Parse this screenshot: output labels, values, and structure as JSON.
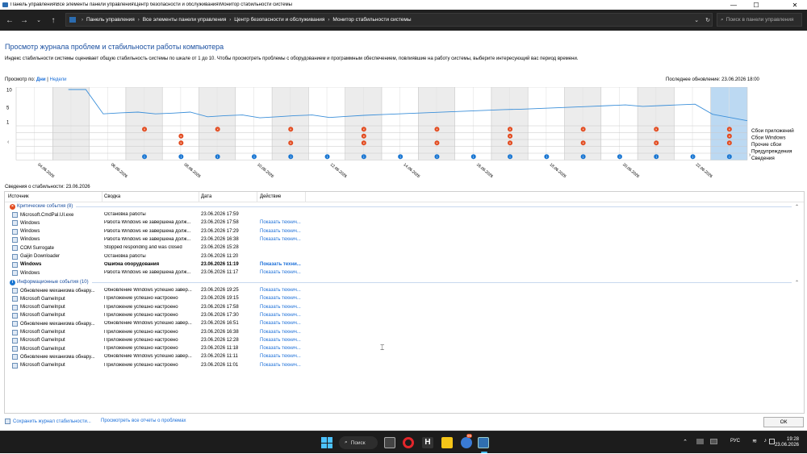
{
  "window": {
    "title": "Панель управления\\Все элементы панели управления\\Центр безопасности и обслуживания\\Монитор стабильности системы"
  },
  "nav": {
    "breadcrumbs": [
      "Панель управления",
      "Все элементы панели управления",
      "Центр безопасности и обслуживания",
      "Монитор стабильности системы"
    ],
    "search_placeholder": "Поиск в панели управления"
  },
  "heading": "Просмотр журнала проблем и стабильности работы компьютера",
  "description": "Индекс стабильности системы оценивает общую стабильность системы по шкале от 1 до 10. Чтобы просмотреть проблемы с оборудованием и программным обеспечением, повлиявшие на работу системы, выберите интересующий вас период времени.",
  "view_by": {
    "label": "Просмотр по:",
    "days": "Дни",
    "sep": "|",
    "weeks": "Недели"
  },
  "last_update": "Последнее обновление: 23.06.2026 18:00",
  "chart_data": {
    "type": "line",
    "yticks": [
      "10",
      "5",
      "1"
    ],
    "ylim": [
      1,
      10
    ],
    "dates": [
      "04.06.2026",
      "06.06.2026",
      "08.06.2026",
      "10.06.2026",
      "12.06.2026",
      "14.06.2026",
      "16.06.2026",
      "18.06.2026",
      "20.06.2026",
      "22.06.2026"
    ],
    "index_values": [
      null,
      null,
      null,
      10,
      10,
      3.2,
      3.5,
      3.7,
      3.2,
      3.4,
      3.7,
      2.4,
      2.7,
      2.9,
      2.1,
      2.4,
      2.7,
      2.9,
      2.2,
      2.5,
      2.8,
      3.0,
      3.2,
      3.4,
      3.6,
      3.8,
      4.0,
      4.2,
      4.4,
      4.5,
      4.7,
      4.9,
      5.1,
      5.3,
      5.5,
      5.7,
      5.3,
      5.5,
      5.7,
      5.9,
      3.1,
      2.2,
      1.3
    ],
    "rows": [
      "Сбои приложений",
      "Сбои Windows",
      "Прочие сбои",
      "Предупреждения",
      "Сведения"
    ],
    "selected_day_index": 19,
    "markers": {
      "app_failures": [
        3,
        5,
        7,
        9,
        11,
        13,
        15,
        17,
        19
      ],
      "windows_failures": [
        4,
        9,
        13,
        19
      ],
      "other_failures": [
        4,
        7,
        9,
        11,
        13,
        15,
        17,
        19
      ],
      "information": [
        3,
        4,
        5,
        6,
        7,
        8,
        9,
        10,
        11,
        12,
        13,
        14,
        15,
        16,
        17,
        18,
        19
      ]
    }
  },
  "stability_info": "Сведения о стабильности: 23.06.2026",
  "table": {
    "headers": [
      "Источник",
      "Сводка",
      "Дата",
      "Действие"
    ],
    "critical": {
      "label": "Критические события (8)",
      "rows": [
        {
          "source": "Microsoft.CmdPal.UI.exe",
          "summary": "Остановка работы",
          "date": "23.06.2026 17:59",
          "action": ""
        },
        {
          "source": "Windows",
          "summary": "Работа Windows не завершена долж...",
          "date": "23.06.2026 17:58",
          "action": "Показать технич..."
        },
        {
          "source": "Windows",
          "summary": "Работа Windows не завершена долж...",
          "date": "23.06.2026 17:29",
          "action": "Показать технич..."
        },
        {
          "source": "Windows",
          "summary": "Работа Windows не завершена долж...",
          "date": "23.06.2026 16:38",
          "action": "Показать технич..."
        },
        {
          "source": "COM Surrogate",
          "summary": "Stopped responding and was closed",
          "date": "23.06.2026 15:28",
          "action": ""
        },
        {
          "source": "Gaijin Downloader",
          "summary": "Остановка работы",
          "date": "23.06.2026 11:20",
          "action": ""
        },
        {
          "source": "Windows",
          "summary": "Ошибка оборудования",
          "date": "23.06.2026 11:19",
          "action": "Показать техни..."
        },
        {
          "source": "Windows",
          "summary": "Работа Windows не завершена долж...",
          "date": "23.06.2026 11:17",
          "action": "Показать технич..."
        }
      ]
    },
    "info": {
      "label": "Информационные события (10)",
      "rows": [
        {
          "source": "Обновление механизма обнару...",
          "summary": "Обновление Windows успешно завер...",
          "date": "23.06.2026 19:25",
          "action": "Показать технич..."
        },
        {
          "source": "Microsoft GameInput",
          "summary": "Приложение успешно настроено",
          "date": "23.06.2026 19:15",
          "action": "Показать технич..."
        },
        {
          "source": "Microsoft GameInput",
          "summary": "Приложение успешно настроено",
          "date": "23.06.2026 17:58",
          "action": "Показать технич..."
        },
        {
          "source": "Microsoft GameInput",
          "summary": "Приложение успешно настроено",
          "date": "23.06.2026 17:30",
          "action": "Показать технич..."
        },
        {
          "source": "Обновление механизма обнару...",
          "summary": "Обновление Windows успешно завер...",
          "date": "23.06.2026 16:51",
          "action": "Показать технич..."
        },
        {
          "source": "Microsoft GameInput",
          "summary": "Приложение успешно настроено",
          "date": "23.06.2026 16:38",
          "action": "Показать технич..."
        },
        {
          "source": "Microsoft GameInput",
          "summary": "Приложение успешно настроено",
          "date": "23.06.2026 12:28",
          "action": "Показать технич..."
        },
        {
          "source": "Microsoft GameInput",
          "summary": "Приложение успешно настроено",
          "date": "23.06.2026 11:18",
          "action": "Показать технич..."
        },
        {
          "source": "Обновление механизма обнару...",
          "summary": "Обновление Windows успешно завер...",
          "date": "23.06.2026 11:11",
          "action": "Показать технич..."
        },
        {
          "source": "Microsoft GameInput",
          "summary": "Приложение успешно настроено",
          "date": "23.06.2026 11:01",
          "action": "Показать технич..."
        }
      ]
    }
  },
  "bottom": {
    "save_link": "Сохранить журнал стабильности...",
    "all_reports_link": "Просмотреть все отчеты о проблемах",
    "ok": "ОК"
  },
  "taskbar": {
    "search": "Поиск",
    "lang": "РУС",
    "time": "19:28",
    "date": "23.06.2026",
    "badge": "99"
  },
  "colors": {
    "accent": "#1a6ed8",
    "error": "#e24a1e",
    "info": "#1976d2",
    "line": "#3b8fd9",
    "selected": "#bcd9f2"
  }
}
